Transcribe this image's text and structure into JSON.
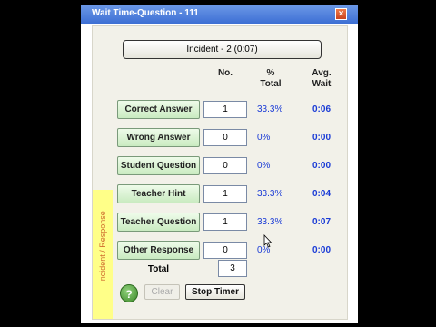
{
  "window": {
    "title": "Wait Time-Question - 111",
    "close_glyph": "×"
  },
  "incident_button": "Incident - 2 (0:07)",
  "headers": {
    "no": "No.",
    "pct": "%\nTotal",
    "avg": "Avg.\nWait"
  },
  "rows": [
    {
      "label": "Correct Answer",
      "count": "1",
      "pct": "33.3%",
      "avg": "0:06"
    },
    {
      "label": "Wrong Answer",
      "count": "0",
      "pct": "0%",
      "avg": "0:00"
    },
    {
      "label": "Student Question",
      "count": "0",
      "pct": "0%",
      "avg": "0:00"
    },
    {
      "label": "Teacher Hint",
      "count": "1",
      "pct": "33.3%",
      "avg": "0:04"
    },
    {
      "label": "Teacher Question",
      "count": "1",
      "pct": "33.3%",
      "avg": "0:07"
    },
    {
      "label": "Other Response",
      "count": "0",
      "pct": "0%",
      "avg": "0:00"
    }
  ],
  "total": {
    "label": "Total",
    "value": "3"
  },
  "footer": {
    "help": "?",
    "clear": "Clear",
    "stop_timer": "Stop Timer"
  },
  "sidebar_label": "Incident / Response",
  "colors": {
    "title_bar": "#3d6fd4",
    "row_button": "#c9ebc1",
    "value_text": "#1a3bd6",
    "sidebar": "#ffff88"
  },
  "icons": {
    "close": "close-icon",
    "help": "help-icon",
    "cursor": "hand-cursor-icon"
  }
}
